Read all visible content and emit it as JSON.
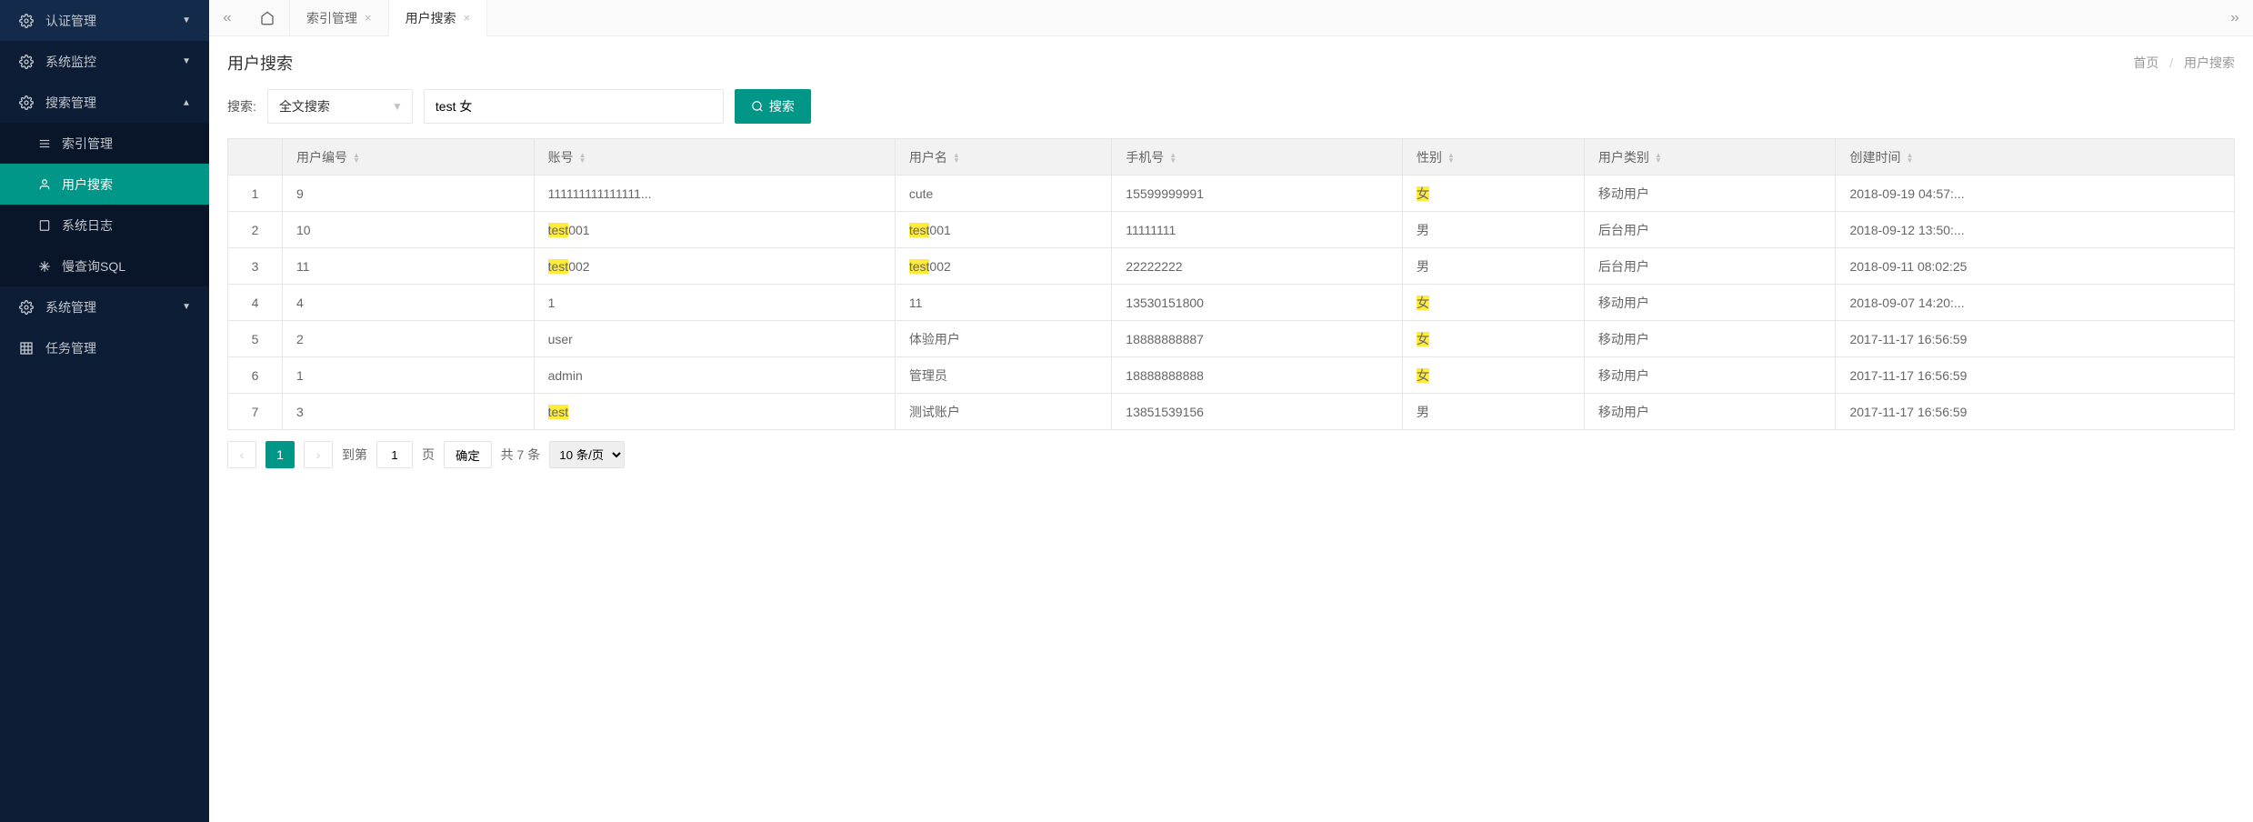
{
  "sidebar": {
    "items": [
      {
        "label": "认证管理",
        "icon": "gear-icon",
        "expanded": false
      },
      {
        "label": "系统监控",
        "icon": "gear-icon",
        "expanded": false
      },
      {
        "label": "搜索管理",
        "icon": "gear-icon",
        "expanded": true,
        "children": [
          {
            "label": "索引管理",
            "icon": "menu-icon",
            "active": false
          },
          {
            "label": "用户搜索",
            "icon": "user-icon",
            "active": true
          },
          {
            "label": "系统日志",
            "icon": "file-icon",
            "active": false
          },
          {
            "label": "慢查询SQL",
            "icon": "snow-icon",
            "active": false
          }
        ]
      },
      {
        "label": "系统管理",
        "icon": "gear-icon",
        "expanded": false
      },
      {
        "label": "任务管理",
        "icon": "grid-icon",
        "expanded": false
      }
    ]
  },
  "tabs": {
    "items": [
      {
        "label": "索引管理",
        "active": false
      },
      {
        "label": "用户搜索",
        "active": true
      }
    ]
  },
  "page": {
    "title": "用户搜索",
    "breadcrumb": {
      "home": "首页",
      "current": "用户搜索"
    }
  },
  "search": {
    "label": "搜索:",
    "type_value": "全文搜索",
    "input_value": "test 女",
    "button_label": "搜索"
  },
  "table": {
    "columns": [
      {
        "label": "用户编号"
      },
      {
        "label": "账号"
      },
      {
        "label": "用户名"
      },
      {
        "label": "手机号"
      },
      {
        "label": "性别"
      },
      {
        "label": "用户类别"
      },
      {
        "label": "创建时间"
      }
    ],
    "rows": [
      {
        "idx": "1",
        "user_id": "9",
        "account": "111111111111111...",
        "username": "cute",
        "phone": "15599999991",
        "gender": "女",
        "user_type": "移动用户",
        "created": "2018-09-19 04:57:..."
      },
      {
        "idx": "2",
        "user_id": "10",
        "account": "test001",
        "username": "test001",
        "phone": "11111111",
        "gender": "男",
        "user_type": "后台用户",
        "created": "2018-09-12 13:50:..."
      },
      {
        "idx": "3",
        "user_id": "11",
        "account": "test002",
        "username": "test002",
        "phone": "22222222",
        "gender": "男",
        "user_type": "后台用户",
        "created": "2018-09-11 08:02:25"
      },
      {
        "idx": "4",
        "user_id": "4",
        "account": "1",
        "username": "11",
        "phone": "13530151800",
        "gender": "女",
        "user_type": "移动用户",
        "created": "2018-09-07 14:20:..."
      },
      {
        "idx": "5",
        "user_id": "2",
        "account": "user",
        "username": "体验用户",
        "phone": "18888888887",
        "gender": "女",
        "user_type": "移动用户",
        "created": "2017-11-17 16:56:59"
      },
      {
        "idx": "6",
        "user_id": "1",
        "account": "admin",
        "username": "管理员",
        "phone": "18888888888",
        "gender": "女",
        "user_type": "移动用户",
        "created": "2017-11-17 16:56:59"
      },
      {
        "idx": "7",
        "user_id": "3",
        "account": "test",
        "username": "测试账户",
        "phone": "13851539156",
        "gender": "男",
        "user_type": "移动用户",
        "created": "2017-11-17 16:56:59"
      }
    ]
  },
  "highlight_terms": [
    "test",
    "女"
  ],
  "pager": {
    "current": "1",
    "goto_prefix": "到第",
    "goto_value": "1",
    "goto_suffix": "页",
    "confirm": "确定",
    "total": "共 7 条",
    "per_page": "10 条/页"
  }
}
